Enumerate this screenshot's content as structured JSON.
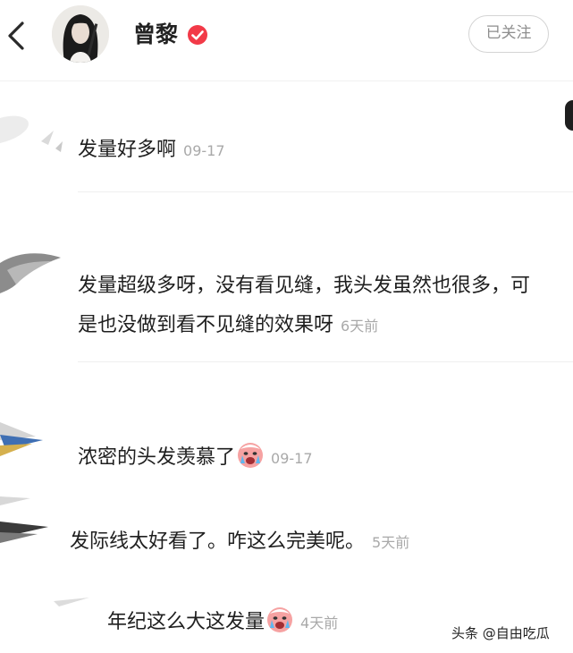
{
  "header": {
    "username": "曾黎",
    "follow_label": "已关注",
    "icons": {
      "back": "chevron-left-icon",
      "verified": "verified-badge-icon"
    },
    "verified_color": "#f23a48"
  },
  "comments": [
    {
      "text": "发量好多啊",
      "date": "09-17"
    },
    {
      "text": "发量超级多呀，没有看见缝，我头发虽然也很多，可是也没做到看不见缝的效果呀",
      "date": "6天前"
    },
    {
      "text": "浓密的头发羡慕了",
      "emoji": "crying-face-emoji-icon",
      "date": "09-17"
    },
    {
      "text": "发际线太好看了。咋这么完美呢。",
      "date": "5天前"
    },
    {
      "text": "年纪这么大这发量",
      "emoji": "crying-face-emoji-icon",
      "date": "4天前"
    }
  ],
  "watermark": {
    "text": "头条 @自由吃瓜"
  },
  "colors": {
    "text": "#1f1f1f",
    "date": "#a9a9a9",
    "divider": "#efefef",
    "follow_border": "#d4d4d4"
  }
}
